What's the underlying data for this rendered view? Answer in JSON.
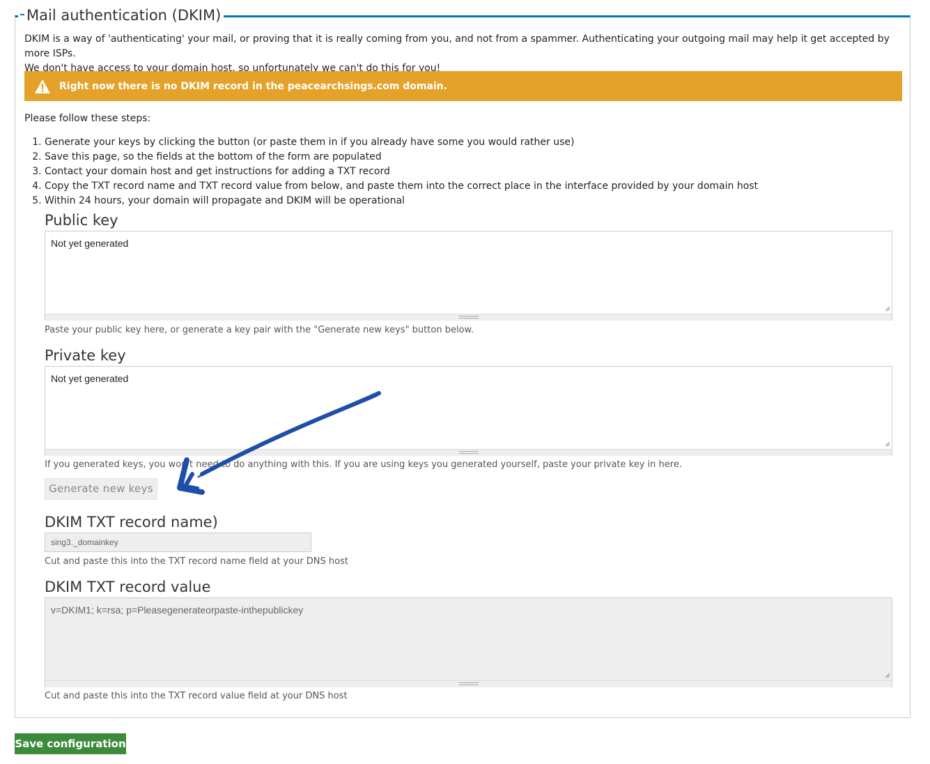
{
  "fieldset": {
    "legend": "Mail authentication (DKIM)",
    "intro_line1": "DKIM is a way of 'authenticating' your mail, or proving that it is really coming from you, and not from a spammer. Authenticating your outgoing mail may help it get accepted by more ISPs.",
    "intro_line2": "We don't have access to your domain host, so unfortunately we can't do this for you!"
  },
  "warning": {
    "text": "Right now there is no DKIM record in the peacearchsings.com domain.",
    "icon": "warning-triangle-icon",
    "color": "#e5a22b"
  },
  "steps": {
    "intro": "Please follow these steps:",
    "items": [
      "Generate your keys by clicking the button (or paste them in if you already have some you would rather use)",
      "Save this page, so the fields at the bottom of the form are populated",
      "Contact your domain host and get instructions for adding a TXT record",
      "Copy the TXT record name and TXT record value from below, and paste them into the correct place in the interface provided by your domain host",
      "Within 24 hours, your domain will propagate and DKIM will be operational"
    ]
  },
  "public_key": {
    "label": "Public key",
    "value": "Not yet generated",
    "help": "Paste your public key here, or generate a key pair with the \"Generate new keys\" button below."
  },
  "private_key": {
    "label": "Private key",
    "value": "Not yet generated",
    "help": "If you generated keys, you won't need to do anything with this. If you are using keys you generated yourself, paste your private key in here."
  },
  "generate_button": {
    "label": "Generate new keys"
  },
  "txt_name": {
    "label": "DKIM TXT record name)",
    "value": "sing3._domainkey",
    "help": "Cut and paste this into the TXT record name field at your DNS host"
  },
  "txt_value": {
    "label": "DKIM TXT record value",
    "value": "v=DKIM1; k=rsa; p=Pleasegenerateorpaste-inthepublickey",
    "help": "Cut and paste this into the TXT record value field at your DNS host"
  },
  "save_button": {
    "label": "Save configuration",
    "color": "#3c8a3c"
  },
  "annotation": {
    "icon": "hand-drawn-arrow-icon",
    "color": "#1f4ea8"
  },
  "colors": {
    "accent": "#0074bd"
  }
}
